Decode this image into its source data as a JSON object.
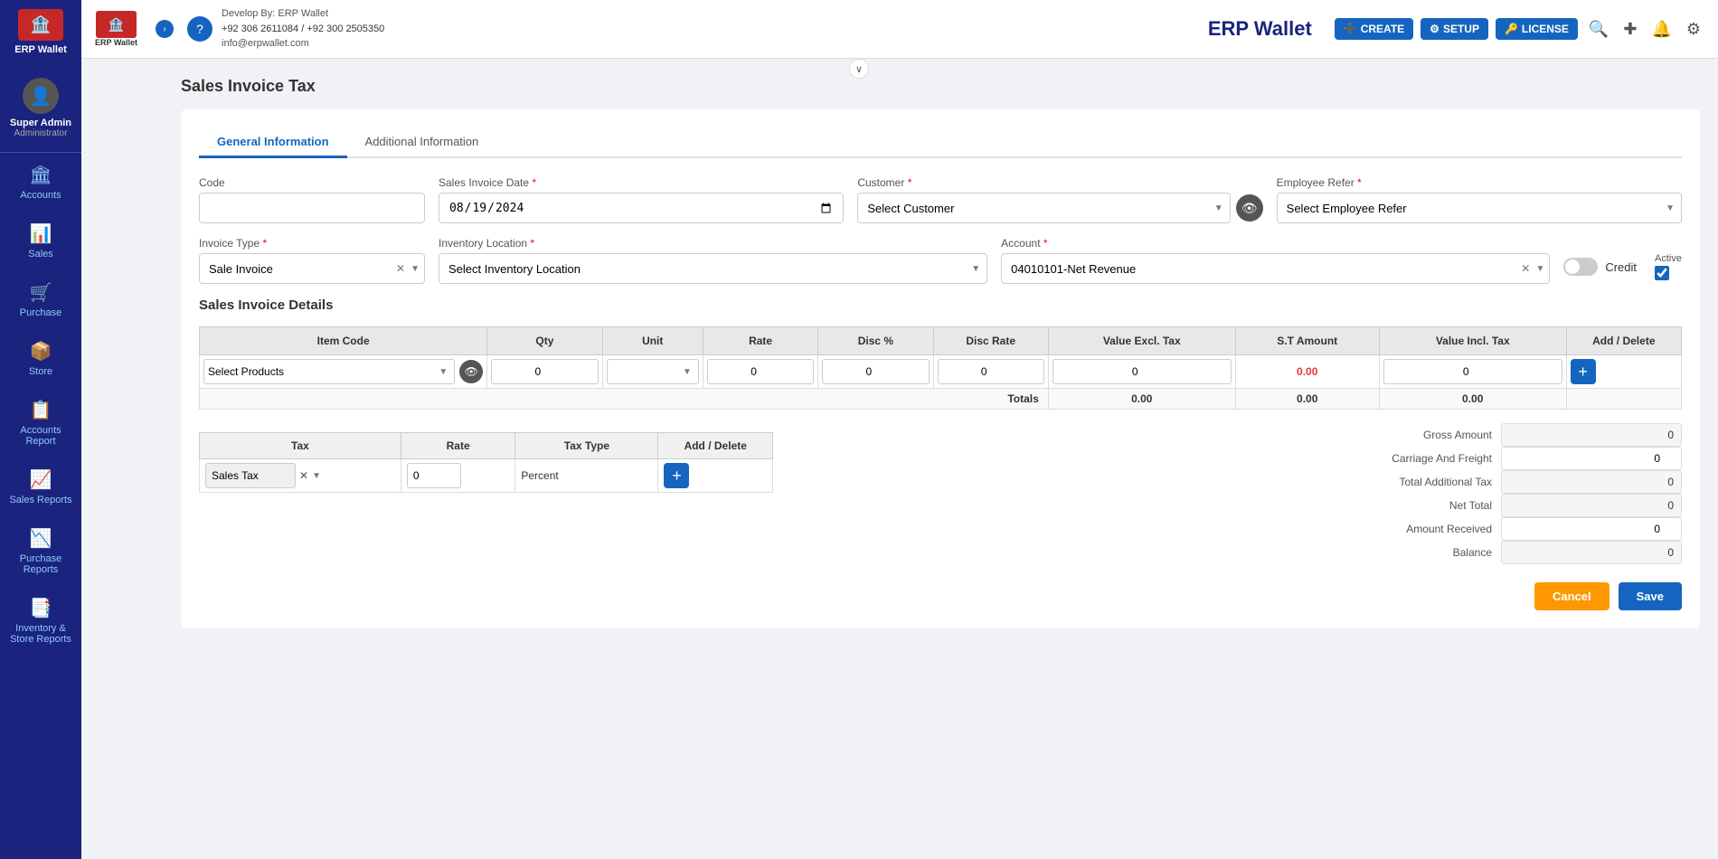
{
  "app": {
    "name": "ERP Wallet",
    "logo_emoji": "🏦",
    "contact": {
      "develop_by": "Develop By: ERP Wallet",
      "phone": "+92 306 2611084 / +92 300 2505350",
      "email": "info@erpwallet.com"
    }
  },
  "topbar": {
    "create_label": "CREATE",
    "setup_label": "SETUP",
    "license_label": "LICENSE"
  },
  "sidebar": {
    "user_name": "Super Admin",
    "user_role": "Administrator",
    "items": [
      {
        "id": "accounts",
        "label": "Accounts",
        "icon": "🏛"
      },
      {
        "id": "sales",
        "label": "Sales",
        "icon": "📊"
      },
      {
        "id": "purchase",
        "label": "Purchase",
        "icon": "🛒"
      },
      {
        "id": "store",
        "label": "Store",
        "icon": "📦"
      },
      {
        "id": "accounts-report",
        "label": "Accounts Report",
        "icon": "📋"
      },
      {
        "id": "sales-reports",
        "label": "Sales Reports",
        "icon": "📈"
      },
      {
        "id": "purchase-reports",
        "label": "Purchase Reports",
        "icon": "📉"
      },
      {
        "id": "inventory-store-reports",
        "label": "Inventory & Store Reports",
        "icon": "📑"
      }
    ]
  },
  "page": {
    "title": "Sales Invoice Tax",
    "tabs": [
      {
        "id": "general",
        "label": "General Information",
        "active": true
      },
      {
        "id": "additional",
        "label": "Additional Information",
        "active": false
      }
    ]
  },
  "form": {
    "code_label": "Code",
    "code_value": "",
    "invoice_date_label": "Sales Invoice Date",
    "invoice_date_required": true,
    "invoice_date_value": "08/19/2024",
    "customer_label": "Customer",
    "customer_required": true,
    "customer_placeholder": "Select Customer",
    "employee_refer_label": "Employee Refer",
    "employee_refer_required": true,
    "employee_refer_placeholder": "Select Employee Refer",
    "invoice_type_label": "Invoice Type",
    "invoice_type_required": true,
    "invoice_type_value": "Sale Invoice",
    "inventory_location_label": "Inventory Location",
    "inventory_location_required": true,
    "inventory_location_placeholder": "Select Inventory Location",
    "account_label": "Account",
    "account_required": true,
    "account_value": "04010101-Net Revenue",
    "credit_label": "Credit",
    "active_label": "Active",
    "active_checked": true
  },
  "details": {
    "section_title": "Sales Invoice Details",
    "columns": [
      "Item Code",
      "Qty",
      "Unit",
      "Rate",
      "Disc %",
      "Disc Rate",
      "Value Excl. Tax",
      "S.T Amount",
      "Value Incl. Tax",
      "Add / Delete"
    ],
    "row": {
      "product_placeholder": "Select Products",
      "qty": "0",
      "rate": "0",
      "disc_percent": "0",
      "disc_rate": "0",
      "value_excl": "0",
      "st_amount": "0.00",
      "value_incl": "0"
    },
    "totals": {
      "label": "Totals",
      "value_excl": "0.00",
      "st_amount": "0.00",
      "value_incl": "0.00"
    }
  },
  "tax": {
    "columns": [
      "Tax",
      "Rate",
      "Tax Type",
      "Add / Delete"
    ],
    "row": {
      "tax_value": "Sales Tax",
      "rate_value": "0",
      "type_value": "Percent"
    }
  },
  "summary": {
    "gross_amount_label": "Gross Amount",
    "gross_amount_value": "0",
    "carriage_label": "Carriage And Freight",
    "carriage_value": "0",
    "total_additional_tax_label": "Total Additional Tax",
    "total_additional_tax_value": "0",
    "net_total_label": "Net Total",
    "net_total_value": "0",
    "amount_received_label": "Amount Received",
    "amount_received_value": "0",
    "balance_label": "Balance",
    "balance_value": "0"
  },
  "actions": {
    "cancel_label": "Cancel",
    "save_label": "Save"
  }
}
